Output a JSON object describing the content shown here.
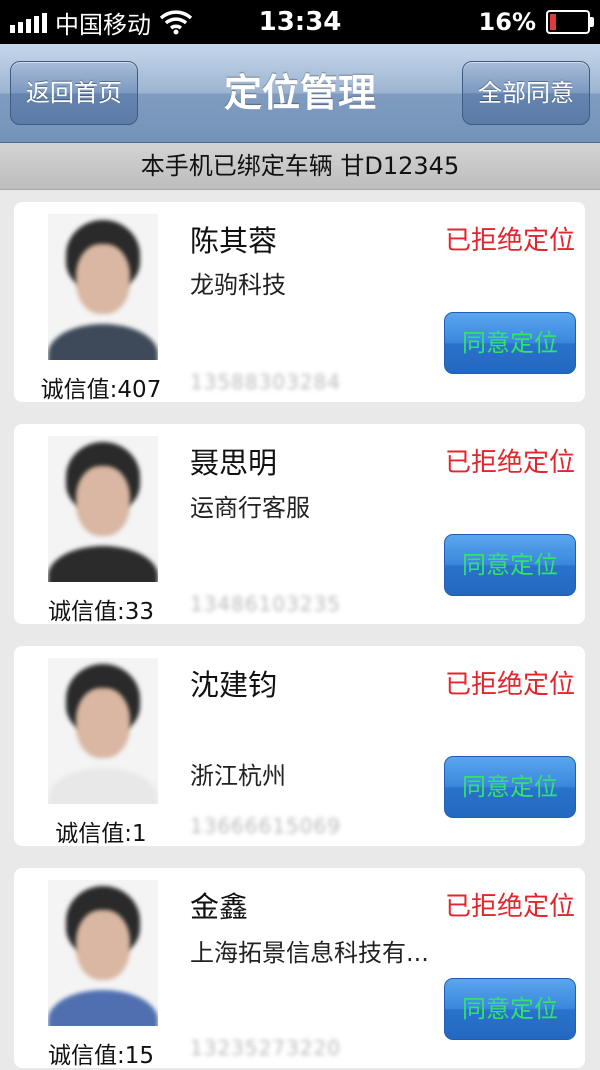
{
  "status_bar": {
    "carrier": "中国移动",
    "time": "13:34",
    "battery": "16%",
    "battery_level": 0.16
  },
  "nav": {
    "back_label": "返回首页",
    "title": "定位管理",
    "agree_all_label": "全部同意"
  },
  "banner": "本手机已绑定车辆 甘D12345",
  "people": [
    {
      "name": "陈其蓉",
      "company": "龙驹科技",
      "status": "已拒绝定位",
      "agree_label": "同意定位",
      "credit": "诚信值:407",
      "phone": "13588303284",
      "shirt_color": "#3e4a5a"
    },
    {
      "name": "聂思明",
      "company": "运商行客服",
      "status": "已拒绝定位",
      "agree_label": "同意定位",
      "credit": "诚信值:33",
      "phone": "13486103235",
      "shirt_color": "#2b2b2b"
    },
    {
      "name": "沈建钧",
      "company": "浙江杭州",
      "status": "已拒绝定位",
      "agree_label": "同意定位",
      "credit": "诚信值:1",
      "phone": "13666615069",
      "shirt_color": "#e8e8e8"
    },
    {
      "name": "金鑫",
      "company": "上海拓景信息科技有...",
      "status": "已拒绝定位",
      "agree_label": "同意定位",
      "credit": "诚信值:15",
      "phone": "13235273220",
      "shirt_color": "#4f6fb0"
    }
  ],
  "colors": {
    "status_red": "#e3252d",
    "agree_text_green": "#32e36a",
    "agree_button_blue": "#3a86dd"
  }
}
